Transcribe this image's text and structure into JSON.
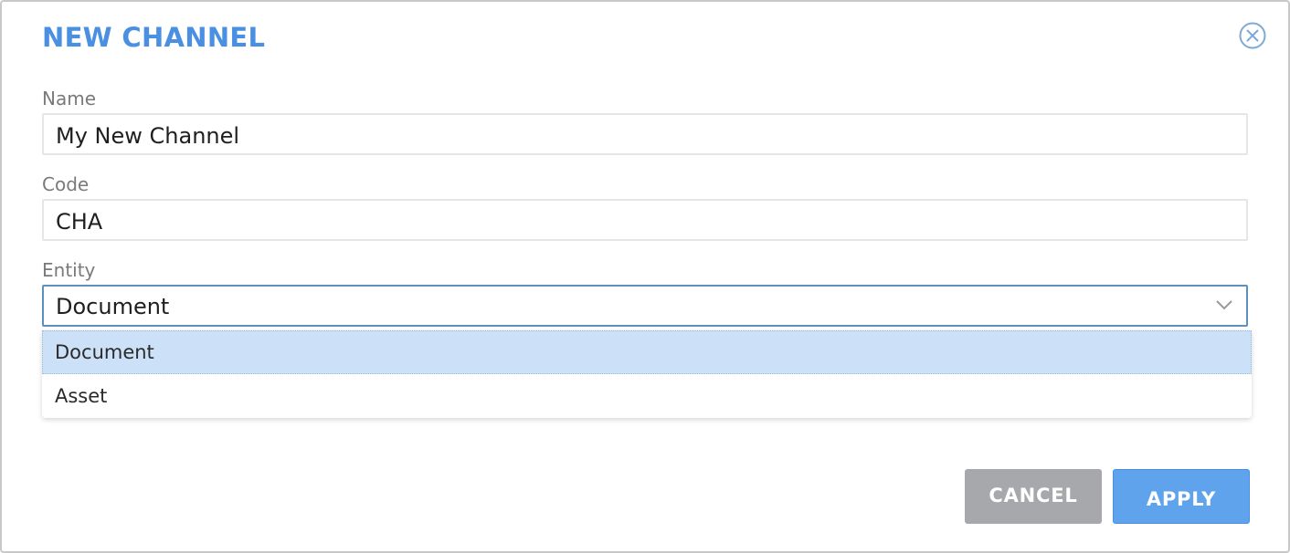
{
  "dialog": {
    "title": "NEW CHANNEL",
    "close_icon": "close-circle-icon"
  },
  "form": {
    "name": {
      "label": "Name",
      "value": "My New Channel"
    },
    "code": {
      "label": "Code",
      "value": "CHA"
    },
    "entity": {
      "label": "Entity",
      "selected": "Document",
      "chevron_icon": "chevron-down-icon",
      "options": [
        "Document",
        "Asset"
      ]
    }
  },
  "footer": {
    "cancel_label": "CANCEL",
    "apply_label": "APPLY"
  },
  "colors": {
    "title": "#4a90e2",
    "apply_button": "#5fa3ec",
    "cancel_button": "#a7a8ab",
    "selected_option": "#cce1f7"
  }
}
